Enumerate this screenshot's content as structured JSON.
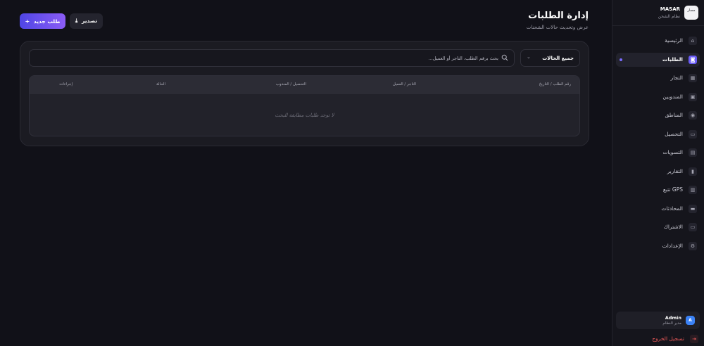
{
  "brand": {
    "name": "MASAR",
    "subtitle": "نظام الشحن",
    "logo_text": "مسار"
  },
  "nav": [
    {
      "label": "الرئيسية",
      "icon": "home-icon",
      "glyph": "⌂"
    },
    {
      "label": "الطلبات",
      "icon": "box-icon",
      "glyph": "◙",
      "active": true
    },
    {
      "label": "التجار",
      "icon": "store-icon",
      "glyph": "▦"
    },
    {
      "label": "المندوبين",
      "icon": "truck-icon",
      "glyph": "▣"
    },
    {
      "label": "المناطق",
      "icon": "map-pin-icon",
      "glyph": "◉"
    },
    {
      "label": "التحصيل",
      "icon": "cash-icon",
      "glyph": "▭"
    },
    {
      "label": "التسويات",
      "icon": "document-icon",
      "glyph": "▤"
    },
    {
      "label": "التقارير",
      "icon": "bar-chart-icon",
      "glyph": "▮"
    },
    {
      "label": "تتبع GPS",
      "icon": "gps-icon",
      "glyph": "▥"
    },
    {
      "label": "المحادثات",
      "icon": "chat-icon",
      "glyph": "▬"
    },
    {
      "label": "الاشتراك",
      "icon": "credit-card-icon",
      "glyph": "▭"
    },
    {
      "label": "الإعدادات",
      "icon": "gear-icon",
      "glyph": "⚙"
    }
  ],
  "user": {
    "name": "Admin",
    "role": "مدير النظام",
    "initial": "A"
  },
  "logout_label": "تسجيل الخروج",
  "header": {
    "title": "إدارة الطلبات",
    "subtitle": "عرض وتحديث حالات الشحنات",
    "new_button": "طلب جديد",
    "export_button": "تصدير"
  },
  "filter": {
    "status_value": "جميع الحالات"
  },
  "search": {
    "placeholder": "بحث برقم الطلب، التاجر أو العميل..."
  },
  "table": {
    "columns": [
      "رقم الطلب / التاريخ",
      "التاجر / العميل",
      "التحصيل / المندوب",
      "الحالة",
      "إجراءات"
    ],
    "empty_message": "لا توجد طلبات مطابقة للبحث"
  },
  "colors": {
    "accent": "#6a5cf5",
    "danger": "#ef5a5a",
    "avatar": "#3b82f6"
  }
}
